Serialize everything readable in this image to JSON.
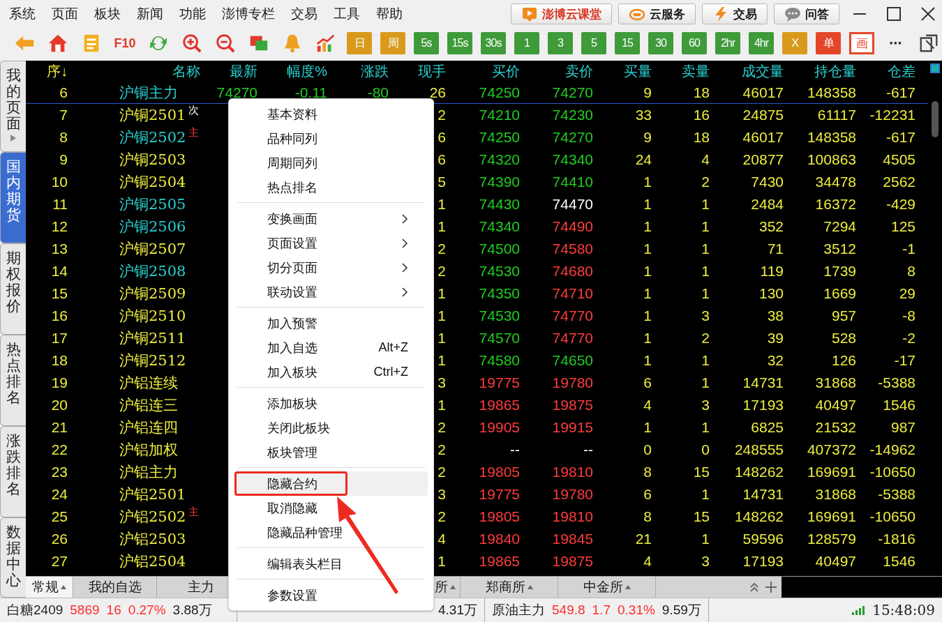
{
  "menu_bar": {
    "items": [
      "系统",
      "页面",
      "板块",
      "新闻",
      "功能",
      "澎博专栏",
      "交易",
      "工具",
      "帮助"
    ],
    "buttons": [
      {
        "label": "澎博云课堂",
        "color": "#d8321e"
      },
      {
        "label": "云服务",
        "color": "#1a1a1a"
      },
      {
        "label": "交易",
        "color": "#1a1a1a"
      },
      {
        "label": "问答",
        "color": "#1a1a1a"
      }
    ]
  },
  "toolbar": [
    {
      "kind": "icon"
    },
    {
      "kind": "icon"
    },
    {
      "kind": "icon"
    },
    {
      "kind": "text",
      "label": "F10",
      "color": "#e0382a"
    },
    {
      "kind": "icon"
    },
    {
      "kind": "icon"
    },
    {
      "kind": "icon"
    },
    {
      "kind": "icon"
    },
    {
      "kind": "icon"
    },
    {
      "kind": "icon"
    },
    {
      "kind": "tile",
      "label": "日",
      "color": "#d99a1c"
    },
    {
      "kind": "tile",
      "label": "周",
      "color": "#d99a1c"
    },
    {
      "kind": "tile",
      "label": "5s",
      "color": "#3f9a3a"
    },
    {
      "kind": "tile",
      "label": "15s",
      "color": "#3f9a3a"
    },
    {
      "kind": "tile",
      "label": "30s",
      "color": "#3f9a3a"
    },
    {
      "kind": "tile",
      "label": "1",
      "color": "#3f9a3a"
    },
    {
      "kind": "tile",
      "label": "3",
      "color": "#3f9a3a"
    },
    {
      "kind": "tile",
      "label": "5",
      "color": "#3f9a3a"
    },
    {
      "kind": "tile",
      "label": "15",
      "color": "#3f9a3a"
    },
    {
      "kind": "tile",
      "label": "30",
      "color": "#3f9a3a"
    },
    {
      "kind": "tile",
      "label": "60",
      "color": "#3f9a3a"
    },
    {
      "kind": "tile",
      "label": "2hr",
      "color": "#3f9a3a"
    },
    {
      "kind": "tile",
      "label": "4hr",
      "color": "#3f9a3a"
    },
    {
      "kind": "tile",
      "label": "X",
      "color": "#d99a1c"
    },
    {
      "kind": "tile",
      "label": "单",
      "color": "#e4462a"
    },
    {
      "kind": "outline",
      "label": "画",
      "color": "#e4462a"
    },
    {
      "kind": "text",
      "label": "⋯",
      "color": "#333333"
    },
    {
      "kind": "icon"
    }
  ],
  "side_tabs": [
    {
      "label": "我的页面",
      "selected": false,
      "arrow": true
    },
    {
      "label": "国内期货",
      "selected": true,
      "arrow": false
    },
    {
      "label": "期权报价",
      "selected": false,
      "arrow": false
    },
    {
      "label": "热点排名",
      "selected": false,
      "arrow": false
    },
    {
      "label": "涨跌排名",
      "selected": false,
      "arrow": false
    },
    {
      "label": "数据中心",
      "selected": false,
      "arrow": false
    }
  ],
  "table": {
    "columns": [
      {
        "label": "序↓",
        "sorted": true
      },
      {
        "label": "名称",
        "sorted": false
      },
      {
        "label": "最新",
        "sorted": false
      },
      {
        "label": "幅度%",
        "sorted": false
      },
      {
        "label": "涨跌",
        "sorted": false
      },
      {
        "label": "现手",
        "sorted": false
      },
      {
        "label": "买价",
        "sorted": false
      },
      {
        "label": "卖价",
        "sorted": false
      },
      {
        "label": "买量",
        "sorted": false
      },
      {
        "label": "卖量",
        "sorted": false
      },
      {
        "label": "成交量",
        "sorted": false
      },
      {
        "label": "持仓量",
        "sorted": false
      },
      {
        "label": "仓差",
        "sorted": false
      }
    ],
    "pinned_row": {
      "seq": "6",
      "name": "沪铜主力",
      "color": "#2ad0d0",
      "last": {
        "text": "74270",
        "color": "#22cc22"
      },
      "pct": {
        "text": "-0.11",
        "color": "#22cc22"
      },
      "chg": {
        "text": "-80",
        "color": "#22cc22"
      },
      "vol_now": "26",
      "bid": {
        "text": "74250",
        "color": "#22cc22"
      },
      "ask": {
        "text": "74270",
        "color": "#22cc22"
      },
      "bid_qty": "9",
      "ask_qty": "18",
      "volume": "46017",
      "oi": "148358",
      "oi_chg": "-617"
    },
    "rows": [
      {
        "seq": "7",
        "name": "沪铜2501",
        "color": "#eeee40",
        "tag": {
          "text": "次",
          "color": "#ffffff"
        },
        "vol_now": "2",
        "bid": {
          "text": "74210",
          "color": "#22cc22"
        },
        "ask": {
          "text": "74230",
          "color": "#22cc22"
        },
        "bid_qty": "33",
        "ask_qty": "16",
        "volume": "24875",
        "oi": "61117",
        "oi_chg": "-12231"
      },
      {
        "seq": "8",
        "name": "沪铜2502",
        "color": "#2ad0d0",
        "tag": {
          "text": "主",
          "color": "#ff3c3c"
        },
        "vol_now": "6",
        "bid": {
          "text": "74250",
          "color": "#22cc22"
        },
        "ask": {
          "text": "74270",
          "color": "#22cc22"
        },
        "bid_qty": "9",
        "ask_qty": "18",
        "volume": "46017",
        "oi": "148358",
        "oi_chg": "-617"
      },
      {
        "seq": "9",
        "name": "沪铜2503",
        "color": "#eeee40",
        "vol_now": "6",
        "bid": {
          "text": "74320",
          "color": "#22cc22"
        },
        "ask": {
          "text": "74340",
          "color": "#22cc22"
        },
        "bid_qty": "24",
        "ask_qty": "4",
        "volume": "20877",
        "oi": "100863",
        "oi_chg": "4505"
      },
      {
        "seq": "10",
        "name": "沪铜2504",
        "color": "#eeee40",
        "vol_now": "5",
        "bid": {
          "text": "74390",
          "color": "#22cc22"
        },
        "ask": {
          "text": "74410",
          "color": "#22cc22"
        },
        "bid_qty": "1",
        "ask_qty": "2",
        "volume": "7430",
        "oi": "34478",
        "oi_chg": "2562"
      },
      {
        "seq": "11",
        "name": "沪铜2505",
        "color": "#2ad0d0",
        "vol_now": "1",
        "bid": {
          "text": "74430",
          "color": "#22cc22"
        },
        "ask": {
          "text": "74470",
          "color": "#ffffff"
        },
        "bid_qty": "1",
        "ask_qty": "1",
        "volume": "2484",
        "oi": "16372",
        "oi_chg": "-429"
      },
      {
        "seq": "12",
        "name": "沪铜2506",
        "color": "#2ad0d0",
        "vol_now": "1",
        "bid": {
          "text": "74340",
          "color": "#22cc22"
        },
        "ask": {
          "text": "74490",
          "color": "#ff3c3c"
        },
        "bid_qty": "1",
        "ask_qty": "1",
        "volume": "352",
        "oi": "7294",
        "oi_chg": "125"
      },
      {
        "seq": "13",
        "name": "沪铜2507",
        "color": "#eeee40",
        "vol_now": "2",
        "bid": {
          "text": "74500",
          "color": "#22cc22"
        },
        "ask": {
          "text": "74580",
          "color": "#ff3c3c"
        },
        "bid_qty": "1",
        "ask_qty": "1",
        "volume": "71",
        "oi": "3512",
        "oi_chg": "-1"
      },
      {
        "seq": "14",
        "name": "沪铜2508",
        "color": "#2ad0d0",
        "vol_now": "2",
        "bid": {
          "text": "74530",
          "color": "#22cc22"
        },
        "ask": {
          "text": "74680",
          "color": "#ff3c3c"
        },
        "bid_qty": "1",
        "ask_qty": "1",
        "volume": "119",
        "oi": "1739",
        "oi_chg": "8"
      },
      {
        "seq": "15",
        "name": "沪铜2509",
        "color": "#eeee40",
        "vol_now": "1",
        "bid": {
          "text": "74350",
          "color": "#22cc22"
        },
        "ask": {
          "text": "74710",
          "color": "#ff3c3c"
        },
        "bid_qty": "1",
        "ask_qty": "1",
        "volume": "130",
        "oi": "1669",
        "oi_chg": "29"
      },
      {
        "seq": "16",
        "name": "沪铜2510",
        "color": "#eeee40",
        "vol_now": "1",
        "bid": {
          "text": "74530",
          "color": "#22cc22"
        },
        "ask": {
          "text": "74770",
          "color": "#ff3c3c"
        },
        "bid_qty": "1",
        "ask_qty": "3",
        "volume": "38",
        "oi": "957",
        "oi_chg": "-8"
      },
      {
        "seq": "17",
        "name": "沪铜2511",
        "color": "#eeee40",
        "vol_now": "1",
        "bid": {
          "text": "74570",
          "color": "#22cc22"
        },
        "ask": {
          "text": "74770",
          "color": "#ff3c3c"
        },
        "bid_qty": "1",
        "ask_qty": "2",
        "volume": "39",
        "oi": "528",
        "oi_chg": "-2"
      },
      {
        "seq": "18",
        "name": "沪铜2512",
        "color": "#eeee40",
        "vol_now": "1",
        "bid": {
          "text": "74580",
          "color": "#22cc22"
        },
        "ask": {
          "text": "74650",
          "color": "#22cc22"
        },
        "bid_qty": "1",
        "ask_qty": "1",
        "volume": "32",
        "oi": "126",
        "oi_chg": "-17"
      },
      {
        "seq": "19",
        "name": "沪铝连续",
        "color": "#eeee40",
        "vol_now": "3",
        "bid": {
          "text": "19775",
          "color": "#ff3c3c"
        },
        "ask": {
          "text": "19780",
          "color": "#ff3c3c"
        },
        "bid_qty": "6",
        "ask_qty": "1",
        "volume": "14731",
        "oi": "31868",
        "oi_chg": "-5388"
      },
      {
        "seq": "20",
        "name": "沪铝连三",
        "color": "#eeee40",
        "vol_now": "1",
        "bid": {
          "text": "19865",
          "color": "#ff3c3c"
        },
        "ask": {
          "text": "19875",
          "color": "#ff3c3c"
        },
        "bid_qty": "4",
        "ask_qty": "3",
        "volume": "17193",
        "oi": "40497",
        "oi_chg": "1546"
      },
      {
        "seq": "21",
        "name": "沪铝连四",
        "color": "#eeee40",
        "vol_now": "2",
        "bid": {
          "text": "19905",
          "color": "#ff3c3c"
        },
        "ask": {
          "text": "19915",
          "color": "#ff3c3c"
        },
        "bid_qty": "1",
        "ask_qty": "1",
        "volume": "6825",
        "oi": "21532",
        "oi_chg": "987"
      },
      {
        "seq": "22",
        "name": "沪铝加权",
        "color": "#eeee40",
        "vol_now": "2",
        "bid": {
          "text": "--",
          "color": "#ffffff"
        },
        "ask": {
          "text": "--",
          "color": "#ffffff"
        },
        "bid_qty": "0",
        "ask_qty": "0",
        "volume": "248555",
        "oi": "407372",
        "oi_chg": "-14962"
      },
      {
        "seq": "23",
        "name": "沪铝主力",
        "color": "#eeee40",
        "vol_now": "2",
        "bid": {
          "text": "19805",
          "color": "#ff3c3c"
        },
        "ask": {
          "text": "19810",
          "color": "#ff3c3c"
        },
        "bid_qty": "8",
        "ask_qty": "15",
        "volume": "148262",
        "oi": "169691",
        "oi_chg": "-10650"
      },
      {
        "seq": "24",
        "name": "沪铝2501",
        "color": "#eeee40",
        "vol_now": "3",
        "bid": {
          "text": "19775",
          "color": "#ff3c3c"
        },
        "ask": {
          "text": "19780",
          "color": "#ff3c3c"
        },
        "bid_qty": "6",
        "ask_qty": "1",
        "volume": "14731",
        "oi": "31868",
        "oi_chg": "-5388"
      },
      {
        "seq": "25",
        "name": "沪铝2502",
        "color": "#eeee40",
        "tag": {
          "text": "主",
          "color": "#ff3c3c"
        },
        "vol_now": "2",
        "bid": {
          "text": "19805",
          "color": "#ff3c3c"
        },
        "ask": {
          "text": "19810",
          "color": "#ff3c3c"
        },
        "bid_qty": "8",
        "ask_qty": "15",
        "volume": "148262",
        "oi": "169691",
        "oi_chg": "-10650"
      },
      {
        "seq": "26",
        "name": "沪铝2503",
        "color": "#eeee40",
        "vol_now": "4",
        "bid": {
          "text": "19840",
          "color": "#ff3c3c"
        },
        "ask": {
          "text": "19845",
          "color": "#ff3c3c"
        },
        "bid_qty": "21",
        "ask_qty": "1",
        "volume": "59596",
        "oi": "128579",
        "oi_chg": "-1816"
      },
      {
        "seq": "27",
        "name": "沪铝2504",
        "color": "#eeee40",
        "vol_now": "1",
        "bid": {
          "text": "19865",
          "color": "#ff3c3c"
        },
        "ask": {
          "text": "19875",
          "color": "#ff3c3c"
        },
        "bid_qty": "4",
        "ask_qty": "3",
        "volume": "17193",
        "oi": "40497",
        "oi_chg": "1546"
      }
    ]
  },
  "bottom_tabs": [
    {
      "label": "常规",
      "selected": true,
      "dropdown": true
    },
    {
      "label": "我的自选",
      "selected": false,
      "dropdown": false
    },
    {
      "label": "主力",
      "selected": false,
      "dropdown": false
    },
    {
      "label": "所",
      "selected": false,
      "dropdown": true
    },
    {
      "label": "郑商所",
      "selected": false,
      "dropdown": true
    },
    {
      "label": "中金所",
      "selected": false,
      "dropdown": true
    }
  ],
  "context_menu": {
    "groups": [
      [
        {
          "label": "基本资料",
          "submenu": false,
          "selected": false
        },
        {
          "label": "品种同列",
          "submenu": false,
          "selected": false
        },
        {
          "label": "周期同列",
          "submenu": false,
          "selected": false
        },
        {
          "label": "热点排名",
          "submenu": false,
          "selected": false
        }
      ],
      [
        {
          "label": "变换画面",
          "submenu": true,
          "selected": false
        },
        {
          "label": "页面设置",
          "submenu": true,
          "selected": false
        },
        {
          "label": "切分页面",
          "submenu": true,
          "selected": false
        },
        {
          "label": "联动设置",
          "submenu": true,
          "selected": false
        }
      ],
      [
        {
          "label": "加入预警",
          "submenu": false,
          "selected": false
        },
        {
          "label": "加入自选",
          "submenu": false,
          "selected": false,
          "shortcut": "Alt+Z"
        },
        {
          "label": "加入板块",
          "submenu": false,
          "selected": false,
          "shortcut": "Ctrl+Z"
        }
      ],
      [
        {
          "label": "添加板块",
          "submenu": false,
          "selected": false
        },
        {
          "label": "关闭此板块",
          "submenu": false,
          "selected": false
        },
        {
          "label": "板块管理",
          "submenu": false,
          "selected": false
        }
      ],
      [
        {
          "label": "隐藏合约",
          "submenu": false,
          "selected": true
        },
        {
          "label": "取消隐藏",
          "submenu": false,
          "selected": false
        },
        {
          "label": "隐藏品种管理",
          "submenu": false,
          "selected": false
        }
      ],
      [
        {
          "label": "编辑表头栏目",
          "submenu": false,
          "selected": false
        }
      ],
      [
        {
          "label": "参数设置",
          "submenu": false,
          "selected": false
        }
      ]
    ]
  },
  "status_bar": {
    "quotes": [
      {
        "name": "白糖2409",
        "price": "5869",
        "change": "16",
        "pct": "0.27%",
        "amount": "3.88万"
      },
      {
        "amount": "4.31万"
      },
      {
        "name": "原油主力",
        "price": "549.8",
        "change": "1.7",
        "pct": "0.31%",
        "amount": "9.59万"
      }
    ],
    "time": "15:48:09"
  }
}
